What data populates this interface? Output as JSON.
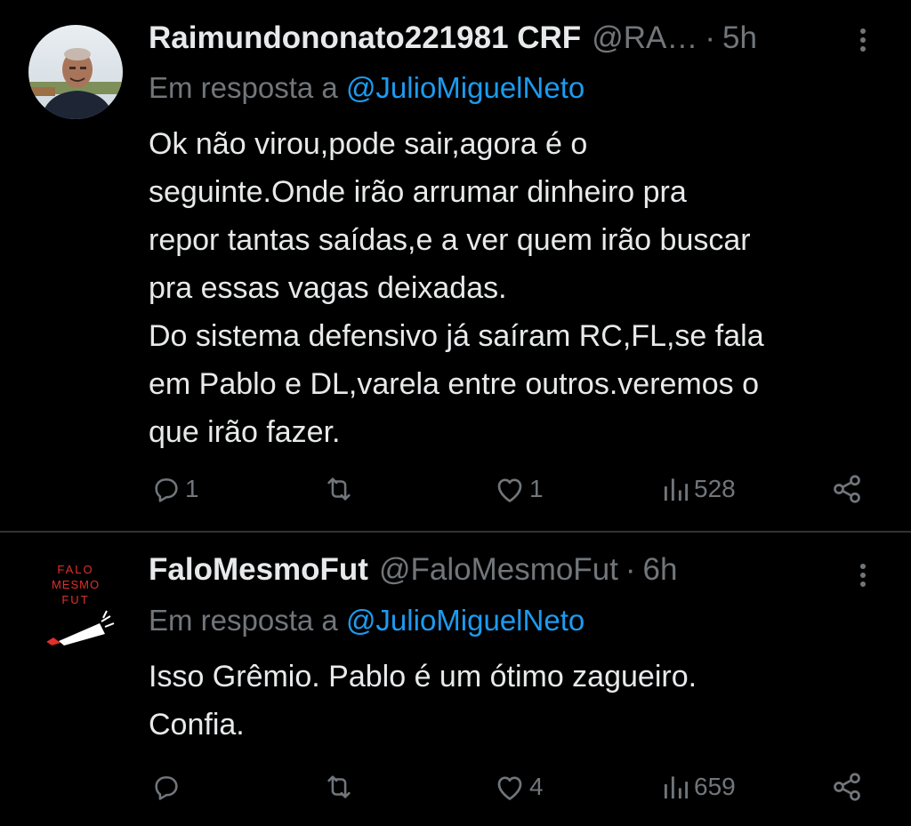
{
  "tweets": [
    {
      "display_name": "Raimundononato221981 CRF",
      "handle": "@RA…",
      "separator": "·",
      "time": "5h",
      "reply_prefix": "Em resposta a",
      "reply_mention": "@JulioMiguelNeto",
      "text_lines": [
        "Ok não virou,pode sair,agora é o",
        "seguinte.Onde irão arrumar dinheiro pra",
        "repor tantas saídas,e a ver quem irão buscar",
        "pra essas vagas deixadas.",
        "Do sistema defensivo já saíram RC,FL,se fala",
        "em Pablo e DL,varela entre outros.veremos o",
        "que irão fazer."
      ],
      "replies": "1",
      "retweets": "",
      "likes": "1",
      "views": "528",
      "avatar_icon": "person-photo-avatar"
    },
    {
      "display_name": "FaloMesmoFut",
      "handle": "@FaloMesmoFut",
      "separator": "·",
      "time": "6h",
      "reply_prefix": "Em resposta a",
      "reply_mention": "@JulioMiguelNeto",
      "text_lines": [
        "Isso Grêmio. Pablo é um ótimo zagueiro.",
        "Confia."
      ],
      "replies": "",
      "retweets": "",
      "likes": "4",
      "views": "659",
      "avatar_logo_lines": [
        "FALO",
        "MESMO",
        "FUT"
      ],
      "avatar_icon": "falomesmofut-logo"
    }
  ],
  "icons": {
    "reply": "speech-bubble-icon",
    "retweet": "retweet-icon",
    "like": "heart-icon",
    "views": "bar-chart-icon",
    "share": "share-icon",
    "more": "more-vertical-icon"
  },
  "colors": {
    "background": "#000000",
    "text": "#e7e9ea",
    "muted": "#71767b",
    "link": "#1d9bf0",
    "divider": "#2f3336",
    "logo_red": "#e0302a"
  }
}
